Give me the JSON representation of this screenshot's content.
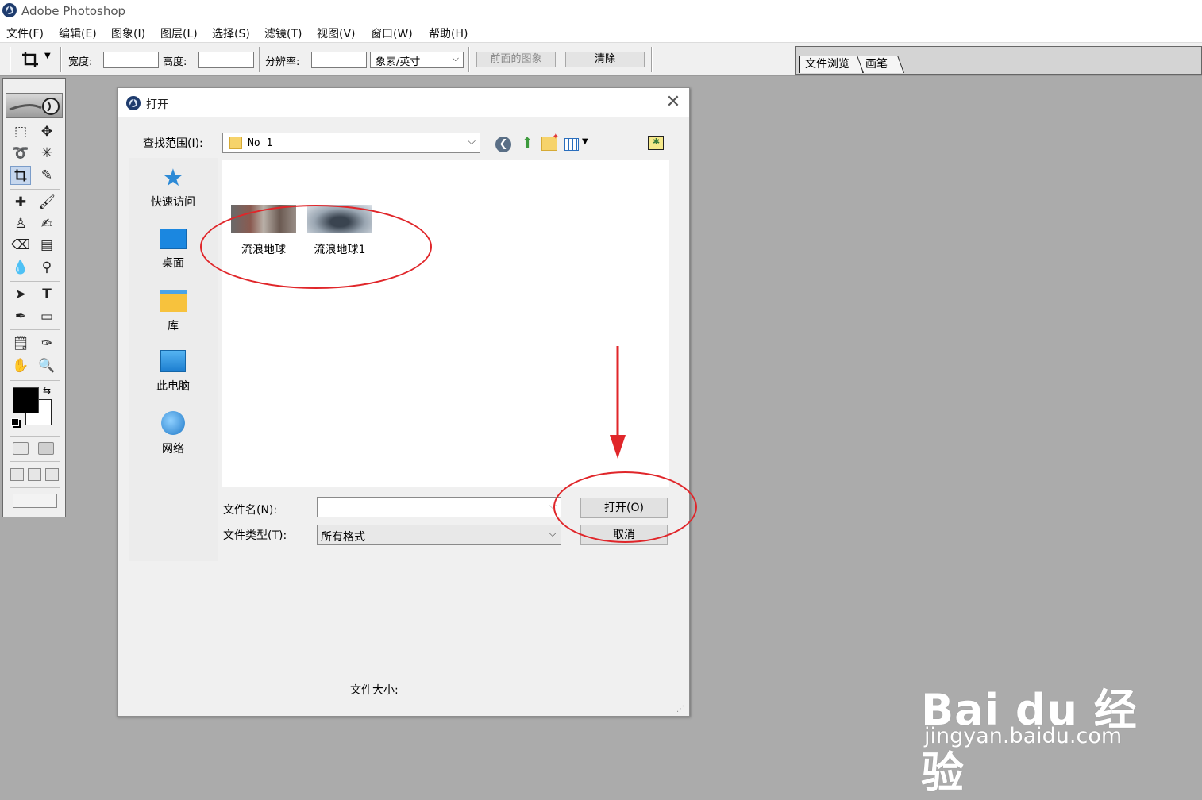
{
  "app": {
    "title": "Adobe Photoshop"
  },
  "menu": [
    "文件(F)",
    "编辑(E)",
    "图象(I)",
    "图层(L)",
    "选择(S)",
    "滤镜(T)",
    "视图(V)",
    "窗口(W)",
    "帮助(H)"
  ],
  "options_bar": {
    "tool_icon": "crop-icon",
    "width_label": "宽度:",
    "height_label": "高度:",
    "resolution_label": "分辨率:",
    "units_value": "象素/英寸",
    "front_image_label": "前面的图象",
    "clear_label": "清除"
  },
  "palette_well": {
    "tabs": [
      "文件浏览",
      "画笔"
    ]
  },
  "colors": {
    "accent_annotation": "#e0262a",
    "foreground": "#000000",
    "background": "#ffffff"
  },
  "dialog": {
    "title": "打开",
    "look_in_label": "查找范围(I):",
    "look_in_value": "No 1",
    "nav_icons": [
      "back-icon",
      "up-folder-icon",
      "new-folder-icon",
      "view-menu-icon"
    ],
    "places": [
      {
        "label": "快速访问",
        "icon": "star-icon"
      },
      {
        "label": "桌面",
        "icon": "desktop-icon"
      },
      {
        "label": "库",
        "icon": "library-icon"
      },
      {
        "label": "此电脑",
        "icon": "computer-icon"
      },
      {
        "label": "网络",
        "icon": "network-icon"
      }
    ],
    "files": [
      {
        "name": "流浪地球"
      },
      {
        "name": "流浪地球1"
      }
    ],
    "filename_label": "文件名(N):",
    "filename_value": "",
    "filetype_label": "文件类型(T):",
    "filetype_value": "所有格式",
    "open_label": "打开(O)",
    "cancel_label": "取消",
    "filesize_label": "文件大小:"
  },
  "watermark": {
    "brand": "Bai du 经验",
    "url": "jingyan.baidu.com"
  }
}
